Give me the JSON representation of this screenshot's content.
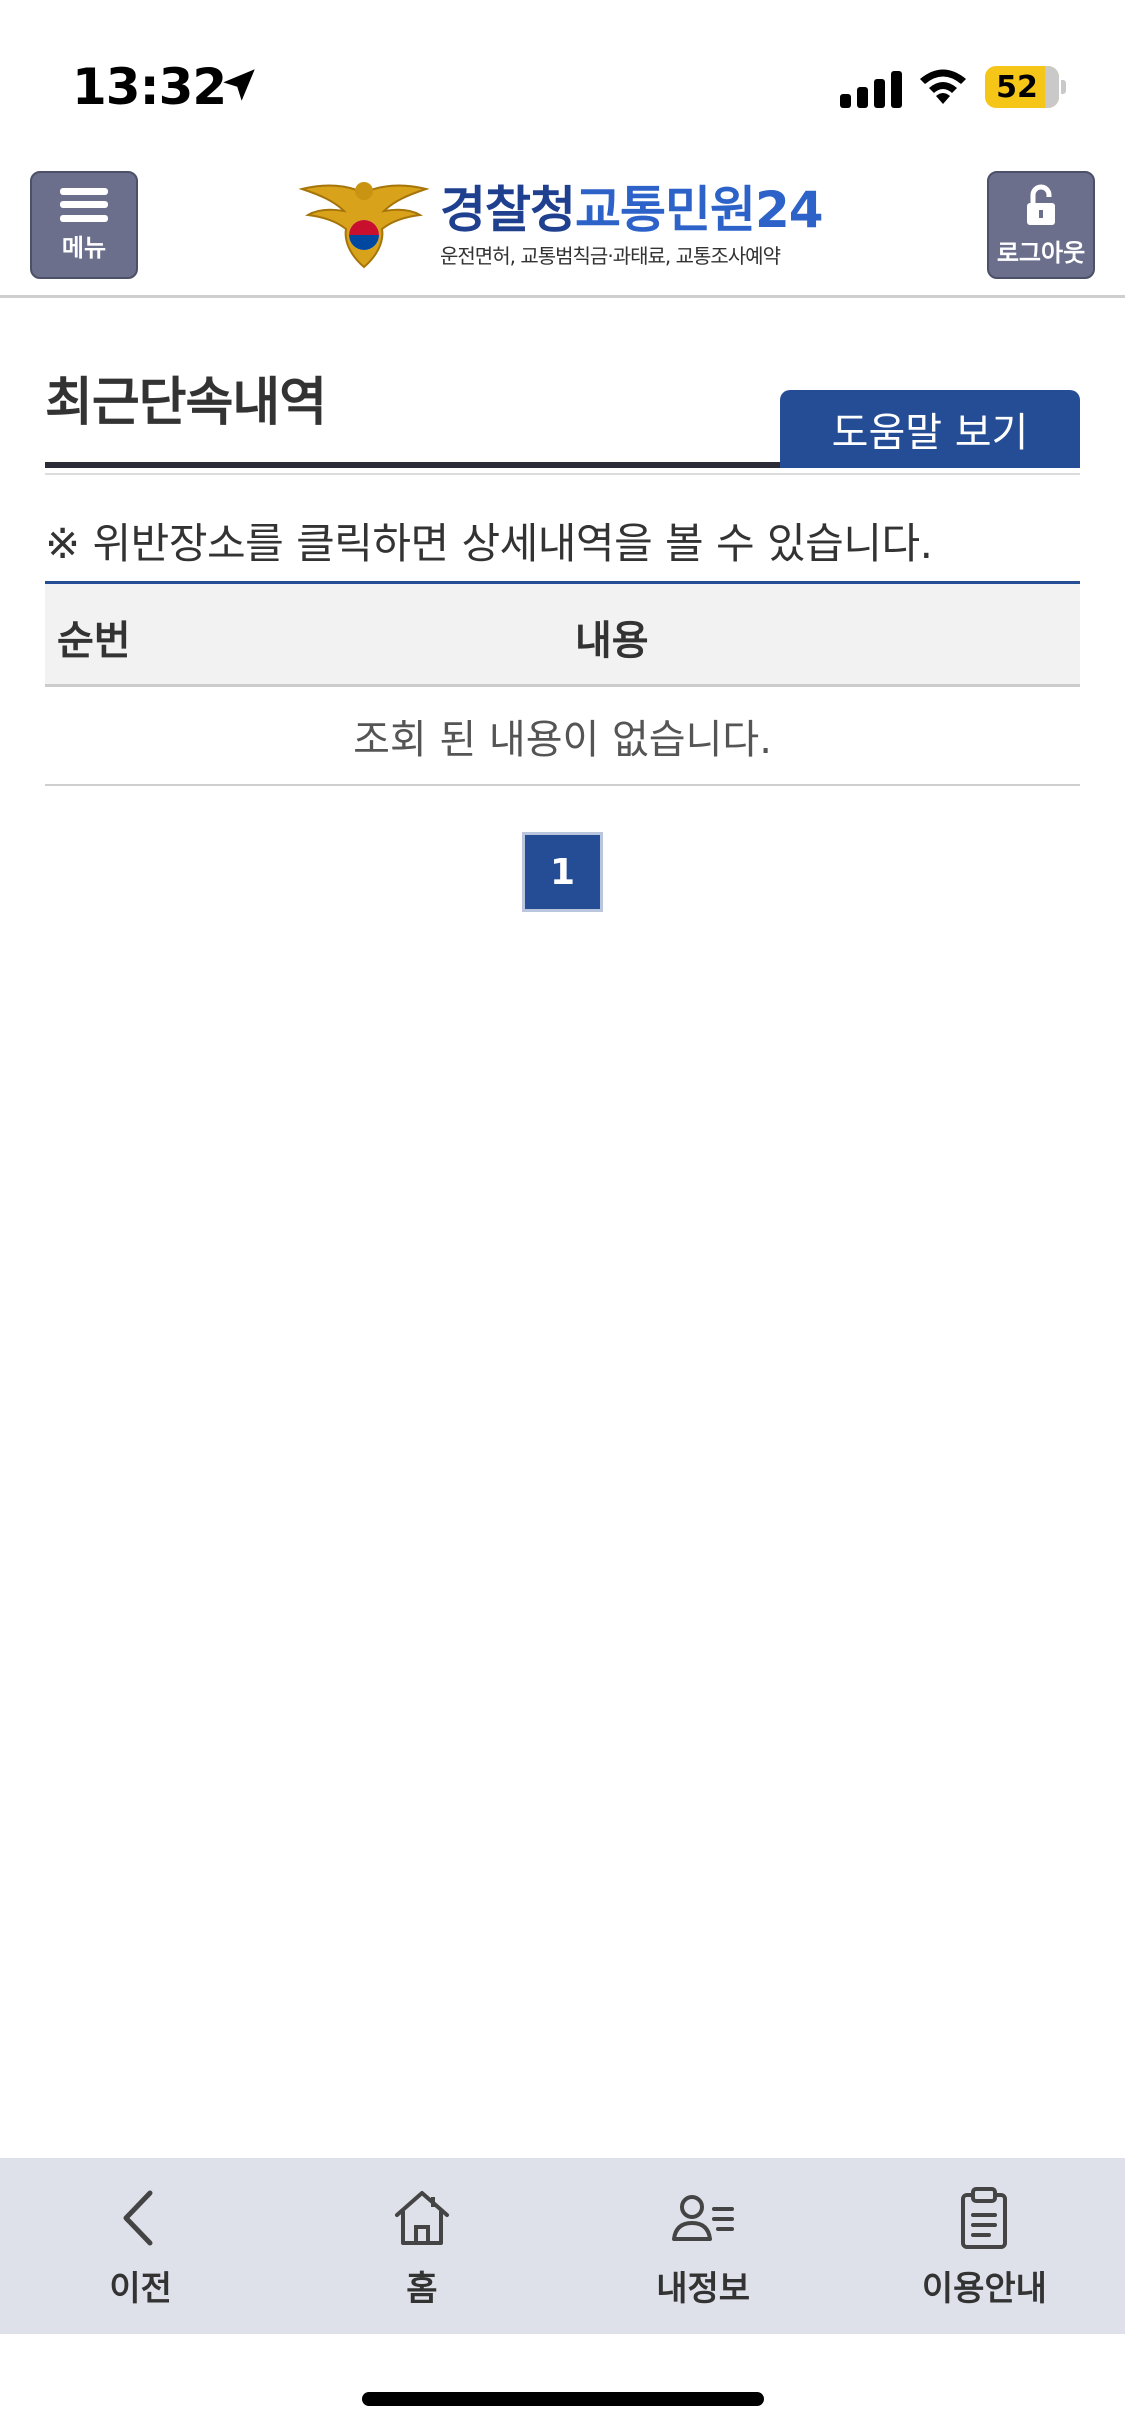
{
  "status_bar": {
    "time": "13:32",
    "battery": "52"
  },
  "header": {
    "menu_label": "메뉴",
    "logout_label": "로그아웃",
    "logo_title_part1": "경찰청",
    "logo_title_part2": "교통민원24",
    "logo_subtitle": "운전면허, 교통범칙금·과태료, 교통조사예약"
  },
  "main": {
    "title": "최근단속내역",
    "help_button": "도움말 보기",
    "notice": "※ 위반장소를 클릭하면 상세내역을 볼 수 있습니다.",
    "table": {
      "columns": [
        "순번",
        "내용"
      ],
      "empty_message": "조회 된 내용이 없습니다."
    },
    "pagination": {
      "current_page": "1"
    }
  },
  "bottom_nav": {
    "items": [
      {
        "label": "이전",
        "icon": "back-chevron-icon"
      },
      {
        "label": "홈",
        "icon": "home-icon"
      },
      {
        "label": "내정보",
        "icon": "profile-icon"
      },
      {
        "label": "이용안내",
        "icon": "clipboard-icon"
      }
    ]
  },
  "colors": {
    "primary": "#244d96",
    "header_button": "#6b6f8c",
    "battery": "#f5c518",
    "nav_background": "#dfe1ea"
  }
}
